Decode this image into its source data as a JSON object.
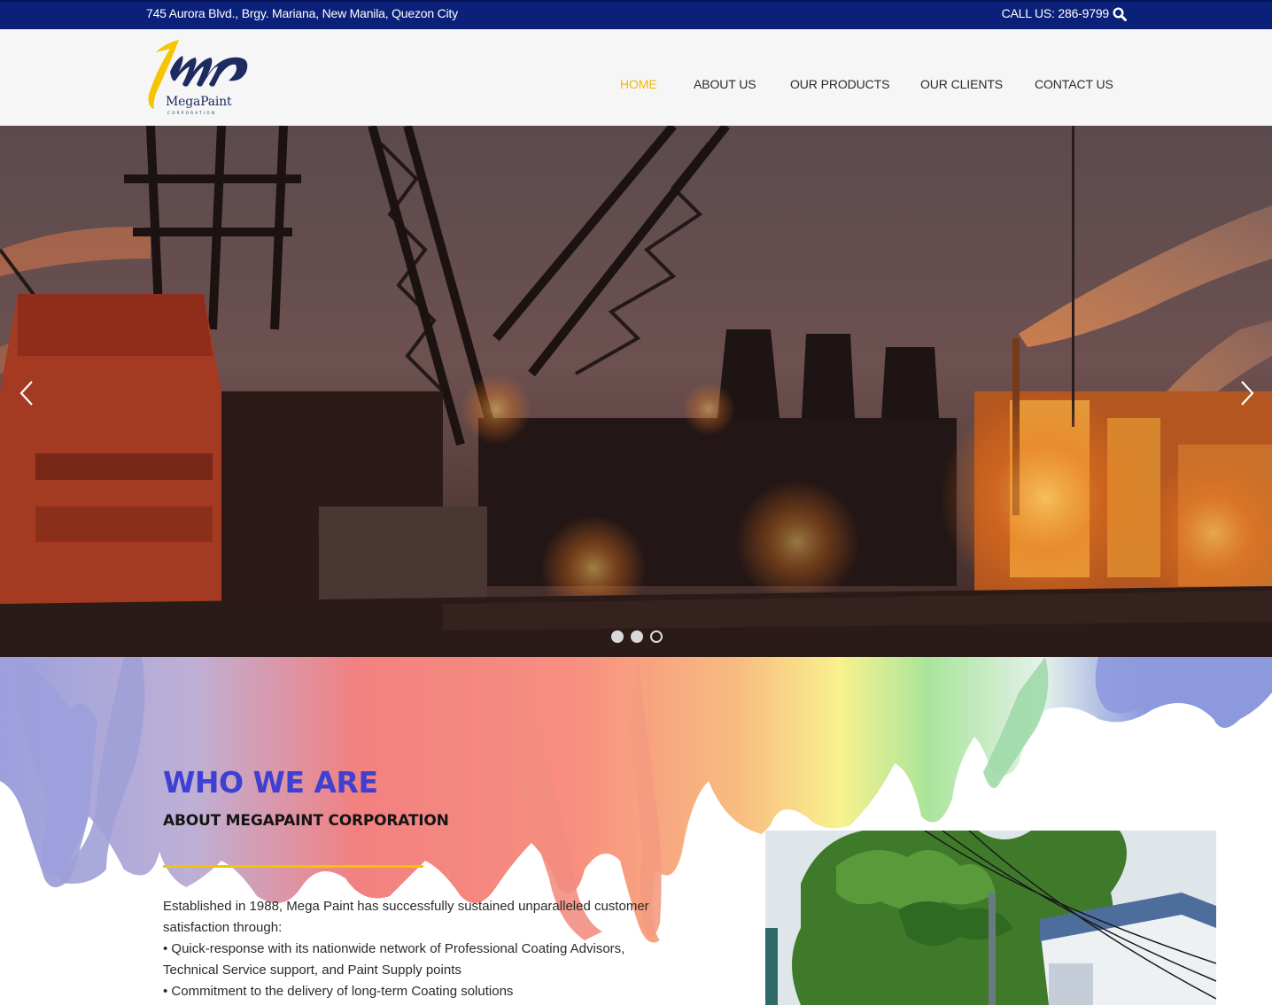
{
  "topbar": {
    "address": "745 Aurora Blvd., Brgy. Mariana, New Manila, Quezon City",
    "call": "CALL US: 286-9799",
    "search_icon": "search-icon",
    "bg_color": "#0b2179"
  },
  "logo": {
    "brand": "MegaPaint",
    "sub": "CORPORATION"
  },
  "nav": {
    "items": [
      {
        "label": "HOME",
        "active": true
      },
      {
        "label": "ABOUT US"
      },
      {
        "label": "OUR PRODUCTS"
      },
      {
        "label": "OUR CLIENTS"
      },
      {
        "label": "CONTACT US"
      }
    ],
    "active_color": "#f2b705"
  },
  "slider": {
    "prev_icon": "chevron-left-icon",
    "next_icon": "chevron-right-icon",
    "slides_count": 3,
    "active_slide": 3
  },
  "about": {
    "title": "WHO WE ARE",
    "subtitle": "ABOUT MEGAPAINT CORPORATION",
    "paragraph_1": "Established in 1988, Mega Paint has successfully sustained unparalleled customer satisfaction through:",
    "bullet_1": "• Quick-response with its nationwide network of Professional Coating Advisors, Technical Service support, and Paint Supply points",
    "bullet_2": "• Commitment to the delivery of long-term Coating solutions",
    "title_color": "#3f3fd2",
    "rule_color": "#f2c300"
  }
}
